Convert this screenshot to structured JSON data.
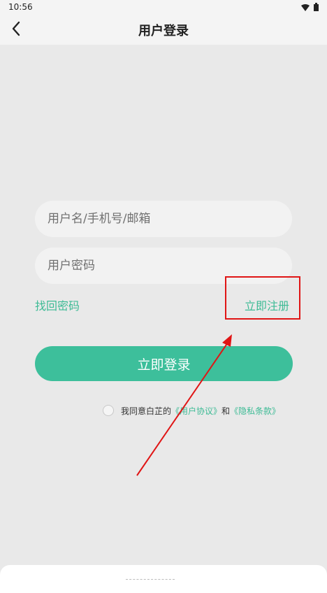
{
  "status_bar": {
    "time": "10:56"
  },
  "nav": {
    "title": "用户登录"
  },
  "form": {
    "username_placeholder": "用户名/手机号/邮箱",
    "password_placeholder": "用户密码",
    "forgot_label": "找回密码",
    "register_label": "立即注册",
    "login_label": "立即登录"
  },
  "agreement": {
    "prefix": "我同意白芷的",
    "user_agreement": "《用户协议》",
    "and": "和",
    "privacy_policy": "《隐私条款》"
  },
  "icons": {
    "back": "chevron-left-icon",
    "wifi": "wifi-icon",
    "battery": "battery-icon"
  },
  "colors": {
    "accent": "#3dbf9b",
    "annotation": "#e01515"
  }
}
